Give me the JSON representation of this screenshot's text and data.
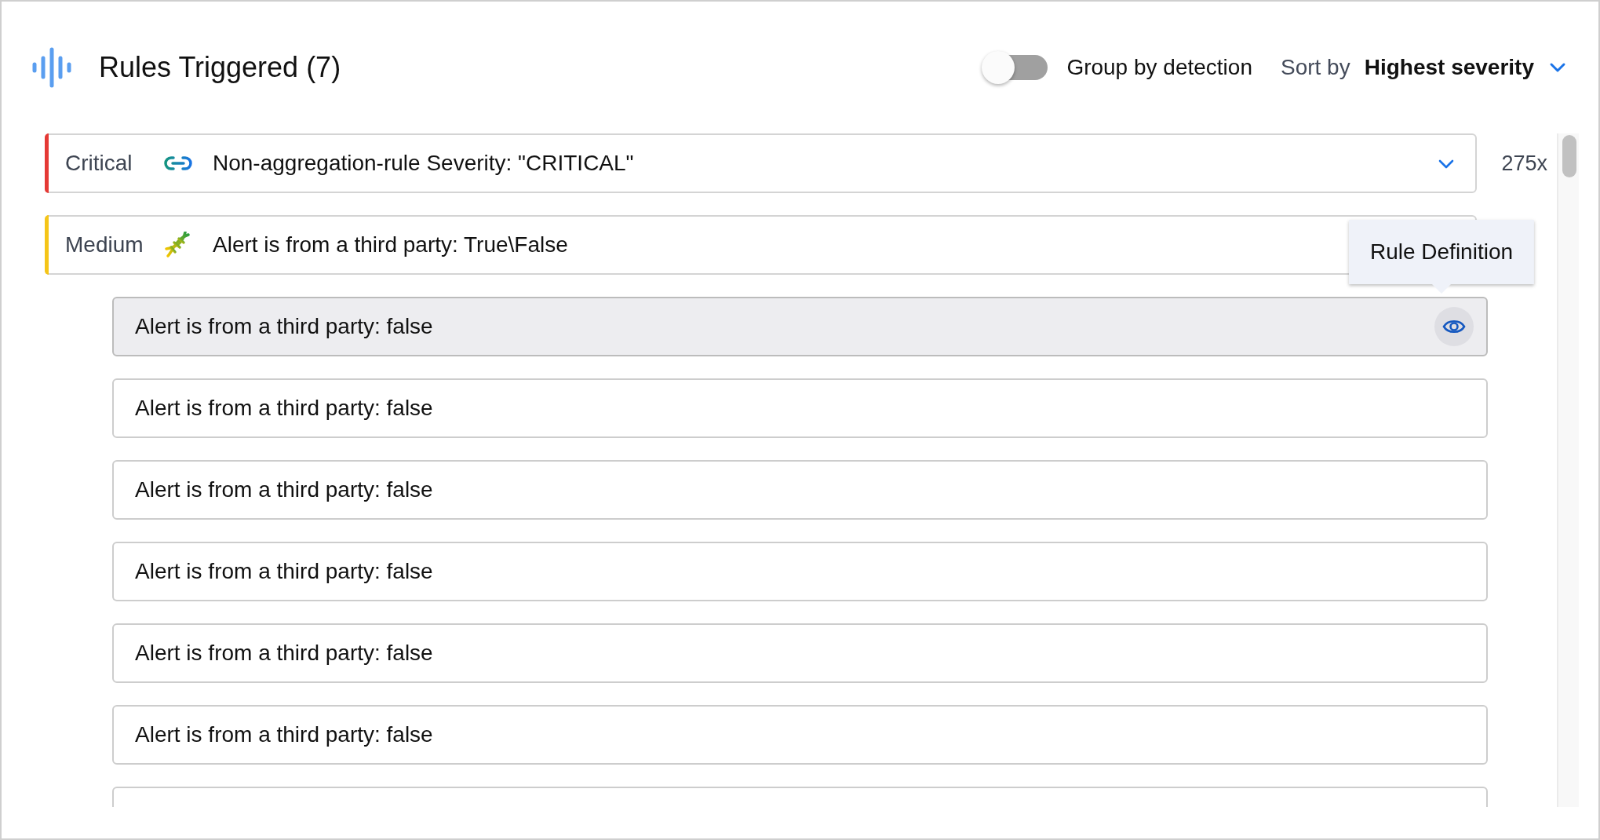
{
  "header": {
    "title": "Rules Triggered (7)",
    "group_toggle": {
      "label": "Group by detection",
      "on": false
    },
    "sort": {
      "label": "Sort by",
      "value": "Highest severity"
    }
  },
  "rules": [
    {
      "severity": "Critical",
      "color": "#e53935",
      "kind": "link",
      "name": "Non-aggregation-rule Severity: \"CRITICAL\"",
      "count": "275x"
    },
    {
      "severity": "Medium",
      "color": "#f5c518",
      "kind": "dna",
      "name": "Alert is from a third party: True\\False",
      "children": [
        {
          "kind": "row",
          "text": "Alert is from a third party: false",
          "hovered": true
        },
        {
          "kind": "row",
          "text": "Alert is from a third party: false",
          "hovered": false
        },
        {
          "kind": "row",
          "text": "Alert is from a third party: false",
          "hovered": false
        },
        {
          "kind": "row",
          "text": "Alert is from a third party: false",
          "hovered": false
        },
        {
          "kind": "row",
          "text": "Alert is from a third party: false",
          "hovered": false
        },
        {
          "kind": "row",
          "text": "Alert is from a third party: false",
          "hovered": false
        },
        {
          "kind": "clipped"
        }
      ]
    }
  ],
  "tooltip": {
    "text": "Rule Definition"
  }
}
